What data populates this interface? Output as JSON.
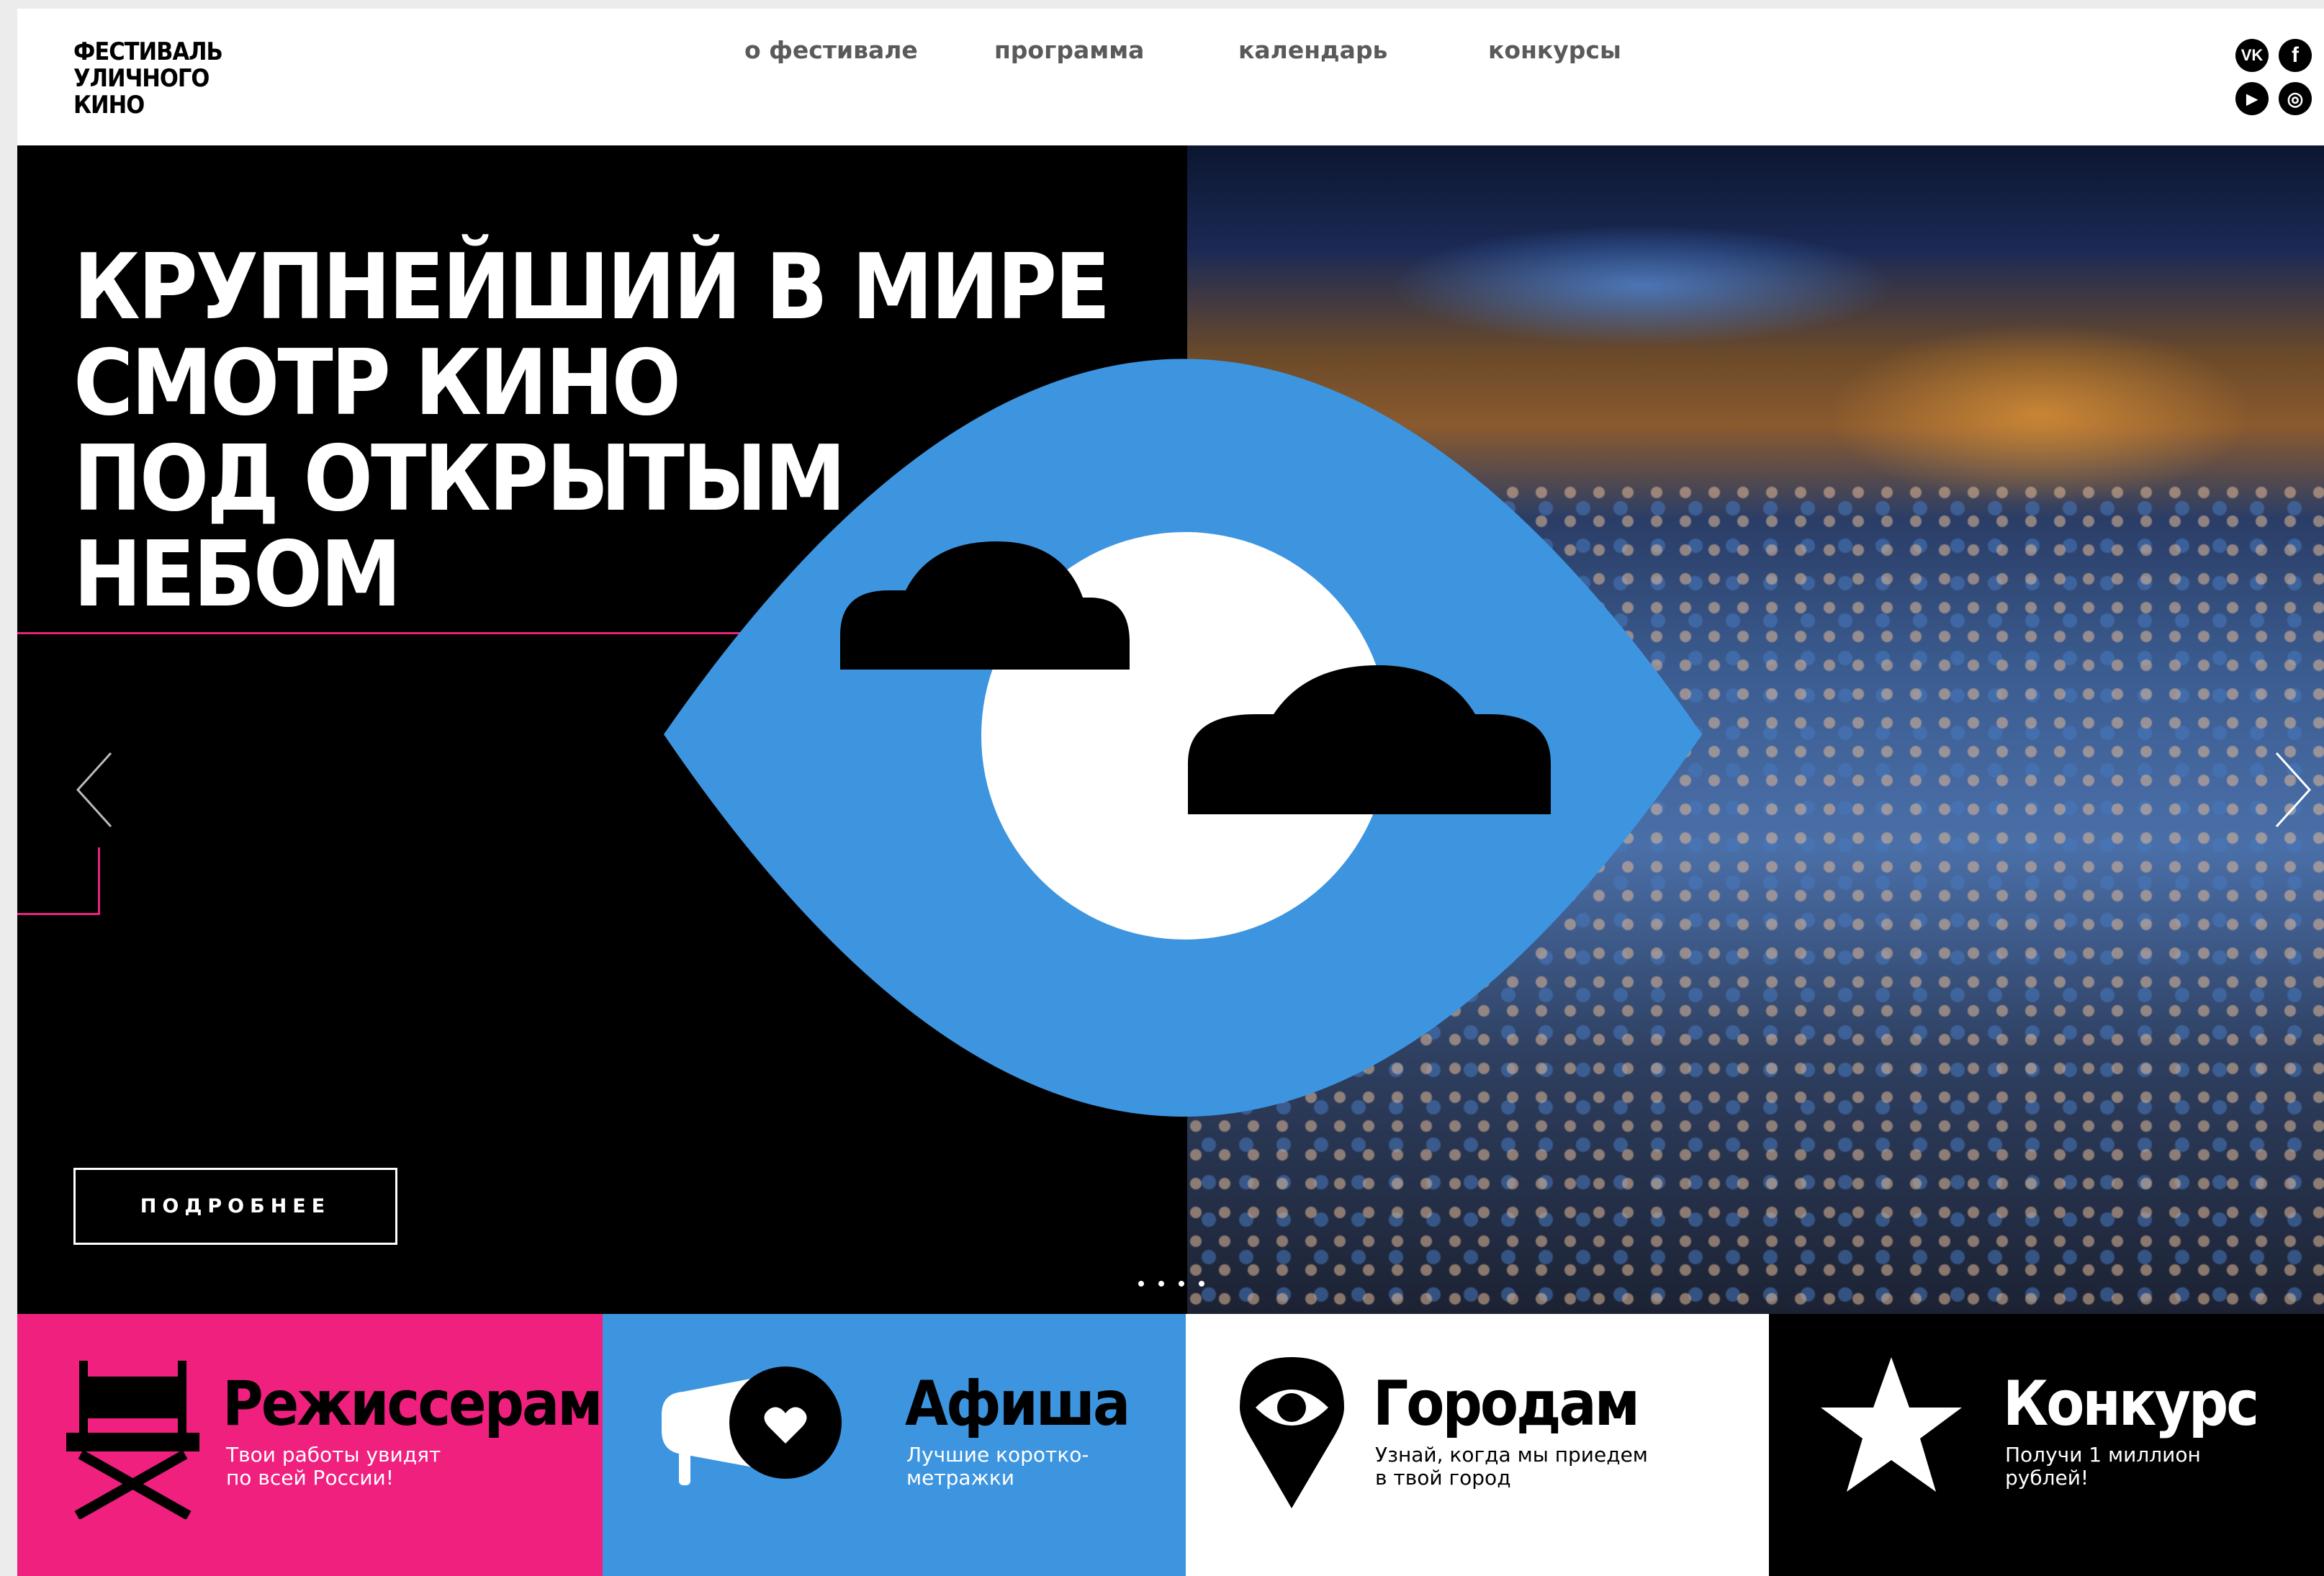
{
  "logo": {
    "lines": [
      "ФЕСТИВАЛЬ",
      "УЛИЧНОГО",
      "КИНО"
    ]
  },
  "nav": {
    "about": "о фестивале",
    "program": "программа",
    "calendar": "календарь",
    "contests": "конкурсы"
  },
  "social": {
    "vk": "VK",
    "facebook": "f",
    "youtube": "▶",
    "instagram": "◎"
  },
  "hero": {
    "headline": [
      "КРУПНЕЙШИЙ В МИРЕ",
      "СМОТР КИНО",
      "ПОД ОТКРЫТЫМ",
      "НЕБОМ"
    ],
    "button": "ПОДРОБНЕЕ",
    "slides_count": 4
  },
  "tiles": [
    {
      "title": "Режиссерам",
      "subtitle": "Твои работы увидят\nпо всей России!"
    },
    {
      "title": "Афиша",
      "subtitle": "Лучшие коротко-\nметражки"
    },
    {
      "title": "Городам",
      "subtitle": "Узнай, когда мы приедем\nв твой город"
    },
    {
      "title": "Конкурс",
      "subtitle": "Получи 1 миллион\nрублей!"
    }
  ],
  "colors": {
    "pink": "#f0207f",
    "blue": "#3d95e0",
    "white": "#ffffff",
    "black": "#000000",
    "accent_line": "#e8227c"
  }
}
